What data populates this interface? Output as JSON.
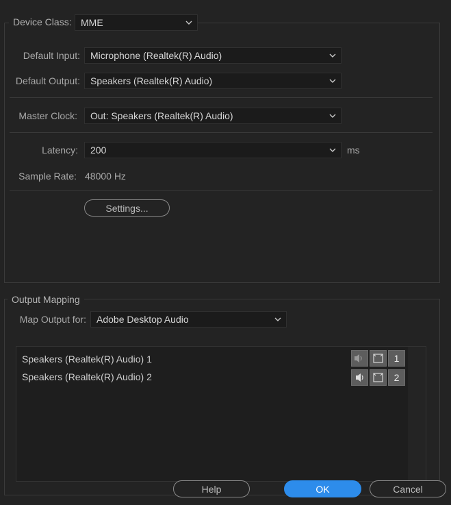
{
  "device_class": {
    "label": "Device Class:",
    "value": "MME"
  },
  "default_input": {
    "label": "Default Input:",
    "value": "Microphone (Realtek(R) Audio)"
  },
  "default_output": {
    "label": "Default Output:",
    "value": "Speakers (Realtek(R) Audio)"
  },
  "master_clock": {
    "label": "Master Clock:",
    "value": "Out: Speakers (Realtek(R) Audio)"
  },
  "latency": {
    "label": "Latency:",
    "value": "200",
    "unit": "ms"
  },
  "sample_rate": {
    "label": "Sample Rate:",
    "value": "48000 Hz"
  },
  "settings_button": "Settings...",
  "output_mapping": {
    "title": "Output Mapping",
    "map_label": "Map Output for:",
    "map_value": "Adobe Desktop Audio",
    "rows": [
      {
        "name": "Speakers (Realtek(R) Audio) 1",
        "channel": "1"
      },
      {
        "name": "Speakers (Realtek(R) Audio) 2",
        "channel": "2"
      }
    ]
  },
  "footer": {
    "help": "Help",
    "ok": "OK",
    "cancel": "Cancel"
  },
  "colors": {
    "accent": "#2d8ceb",
    "background": "#232323"
  }
}
